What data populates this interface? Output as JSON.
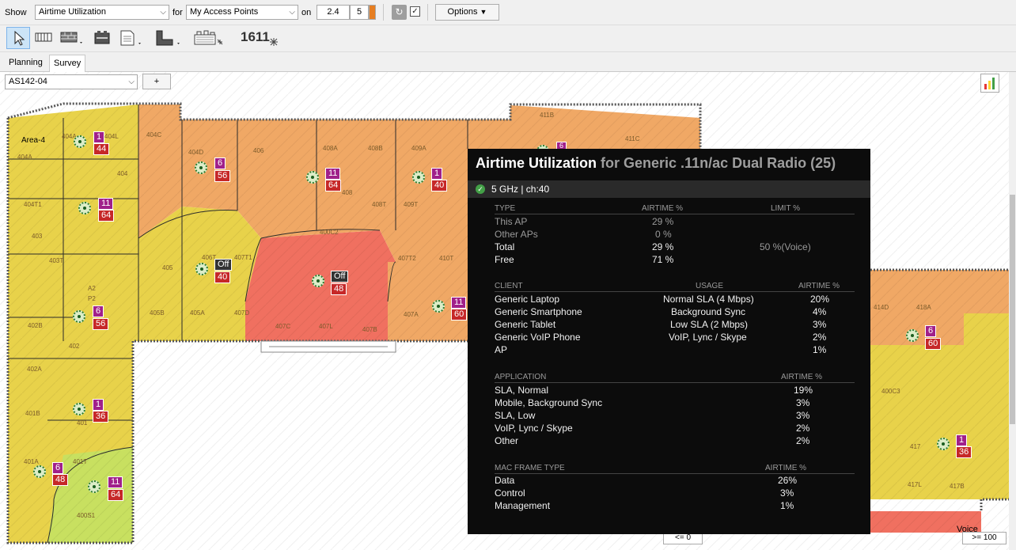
{
  "toolbar": {
    "show_label": "Show",
    "show_value": "Airtime Utilization",
    "for_label": "for",
    "for_value": "My Access Points",
    "on_label": "on",
    "band_a": "2.4",
    "band_b": "5",
    "options_label": "Options"
  },
  "tabs": {
    "planning": "Planning",
    "survey": "Survey"
  },
  "floor_select": {
    "value": "AS142-04",
    "add_label": "+"
  },
  "tools": {
    "counter_text": "1611"
  },
  "rooms": {
    "area4": "Area-4",
    "r404a": "404A",
    "r404l": "404L",
    "r404c": "404C",
    "r404d": "404D",
    "r406": "406",
    "r408a": "408A",
    "r408b": "408B",
    "r409a": "409A",
    "r411b": "411B",
    "r411c": "411C",
    "r404": "404",
    "r404t1": "404T1",
    "r403": "403",
    "r403t": "403T",
    "r405": "405",
    "r406t": "406T",
    "r407t1": "407T1",
    "r408": "408",
    "r408t": "408T",
    "r409t": "409T",
    "r400c2": "400C2",
    "r407t2": "407T2",
    "r410t": "410T",
    "ra2": "A2",
    "rp2": "P2",
    "r402b": "402B",
    "r402": "402",
    "r405b": "405B",
    "r405a": "405A",
    "r407d": "407D",
    "r407c": "407C",
    "r407l": "407L",
    "r407b": "407B",
    "r407a": "407A",
    "r402a": "402A",
    "r401b": "401B",
    "r401": "401",
    "r401a": "401A",
    "r401t": "401T",
    "r400s1": "400S1",
    "r414d": "414D",
    "r418a": "418A",
    "r400c3": "400C3",
    "r417": "417",
    "r417l": "417L",
    "r417b": "417B"
  },
  "access_points": [
    {
      "top": "1",
      "bottom": "44"
    },
    {
      "top": "6",
      "bottom": "56"
    },
    {
      "top": "11",
      "bottom": "64"
    },
    {
      "top": "1",
      "bottom": "40"
    },
    {
      "top": "11",
      "bottom": "64"
    },
    {
      "top": "Off",
      "bottom": "40"
    },
    {
      "top": "Off",
      "bottom": "48"
    },
    {
      "top": "11",
      "bottom": "60"
    },
    {
      "top": "6",
      "bottom": "56"
    },
    {
      "top": "1",
      "bottom": "36"
    },
    {
      "top": "6",
      "bottom": "48"
    },
    {
      "top": "11",
      "bottom": "64"
    },
    {
      "top": "6",
      "bottom": "60"
    },
    {
      "top": "1",
      "bottom": "36"
    },
    {
      "top": "6",
      "bottom": ""
    }
  ],
  "tooltip": {
    "title_main": "Airtime Utilization",
    "title_sub": "for Generic .11n/ac Dual Radio (25)",
    "band": "5 GHz | ch:40",
    "type_section": {
      "headers": [
        "TYPE",
        "AIRTIME %",
        "LIMIT %"
      ],
      "rows": [
        {
          "name": "This AP",
          "airtime": "29 %",
          "limit": ""
        },
        {
          "name": "Other APs",
          "airtime": "0 %",
          "limit": ""
        },
        {
          "name": "Total",
          "airtime": "29 %",
          "limit": "50 %(Voice)"
        },
        {
          "name": "Free",
          "airtime": "71 %",
          "limit": ""
        }
      ]
    },
    "client_section": {
      "headers": [
        "CLIENT",
        "USAGE",
        "AIRTIME %"
      ],
      "rows": [
        {
          "name": "Generic Laptop",
          "usage": "Normal SLA (4 Mbps)",
          "airtime": "20%"
        },
        {
          "name": "Generic Smartphone",
          "usage": "Background Sync",
          "airtime": "4%"
        },
        {
          "name": "Generic Tablet",
          "usage": "Low SLA (2 Mbps)",
          "airtime": "3%"
        },
        {
          "name": "Generic VoIP Phone",
          "usage": "VoIP, Lync / Skype",
          "airtime": "2%"
        },
        {
          "name": "AP",
          "usage": "",
          "airtime": "1%"
        }
      ]
    },
    "application_section": {
      "headers": [
        "APPLICATION",
        "AIRTIME %"
      ],
      "rows": [
        {
          "name": "SLA, Normal",
          "airtime": "19%"
        },
        {
          "name": "Mobile, Background Sync",
          "airtime": "3%"
        },
        {
          "name": "SLA, Low",
          "airtime": "3%"
        },
        {
          "name": "VoIP, Lync / Skype",
          "airtime": "2%"
        },
        {
          "name": "Other",
          "airtime": "2%"
        }
      ]
    },
    "mac_section": {
      "headers": [
        "MAC FRAME TYPE",
        "AIRTIME %"
      ],
      "rows": [
        {
          "name": "Data",
          "airtime": "26%"
        },
        {
          "name": "Control",
          "airtime": "3%"
        },
        {
          "name": "Management",
          "airtime": "1%"
        }
      ]
    }
  },
  "legend": {
    "min_label": "<= 0",
    "max_label": ">= 100",
    "voice_label": "Voice"
  },
  "colors": {
    "low": "#e8d24a",
    "mid": "#f0a865",
    "high": "#f07060",
    "very_low": "#c8e060",
    "badge_channel": "#a0208a",
    "badge_airtime": "#c62828"
  }
}
